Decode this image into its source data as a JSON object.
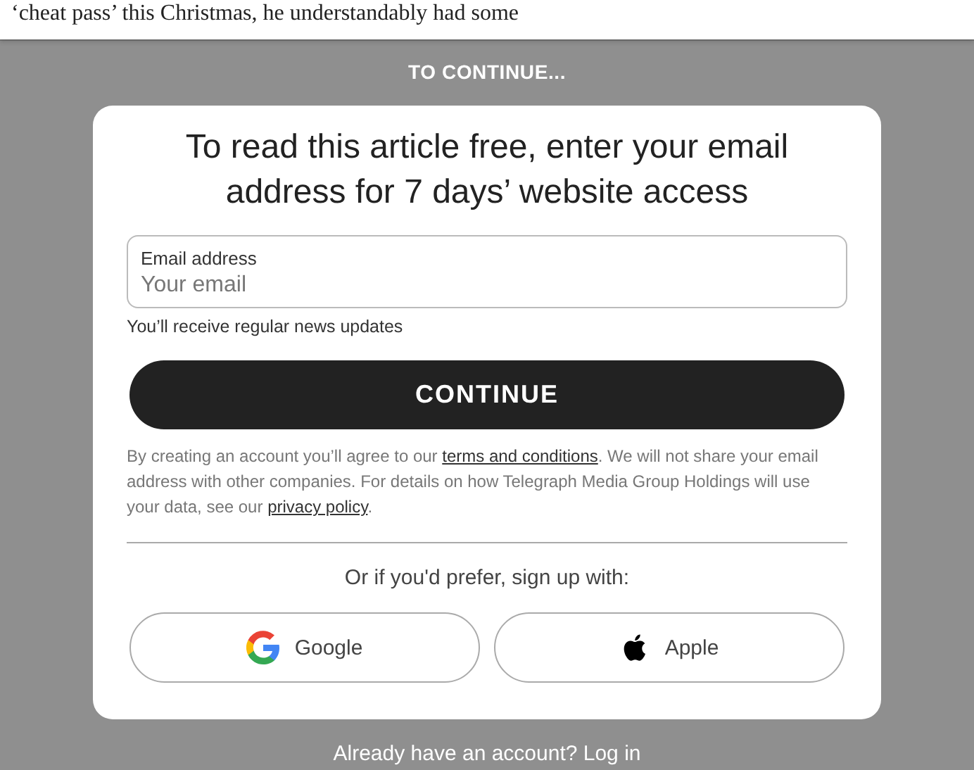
{
  "article": {
    "text_fragment": "‘cheat pass’ this Christmas, he understandably had some"
  },
  "overlay": {
    "heading": "TO CONTINUE...",
    "card": {
      "title": "To read this article free, enter your email address for 7 days’ website access",
      "email_field": {
        "label": "Email address",
        "placeholder": "Your email"
      },
      "hint": "You’ll receive regular news updates",
      "continue_button": "CONTINUE",
      "legal_parts": [
        {
          "kind": "text",
          "text": "By creating an account you’ll agree to our "
        },
        {
          "kind": "link",
          "text": "terms and conditions"
        },
        {
          "kind": "text",
          "text": ". We will not share your email address with other companies. For details on how Telegraph Media Group Holdings will use your data, see our "
        },
        {
          "kind": "link",
          "text": "privacy policy"
        },
        {
          "kind": "text",
          "text": "."
        }
      ],
      "social_prompt": "Or if you'd prefer, sign up with:",
      "social_buttons": [
        {
          "kind": "google",
          "label": "Google"
        },
        {
          "kind": "apple",
          "label": "Apple"
        }
      ]
    },
    "login_prompt": "Already have an account? Log in"
  }
}
